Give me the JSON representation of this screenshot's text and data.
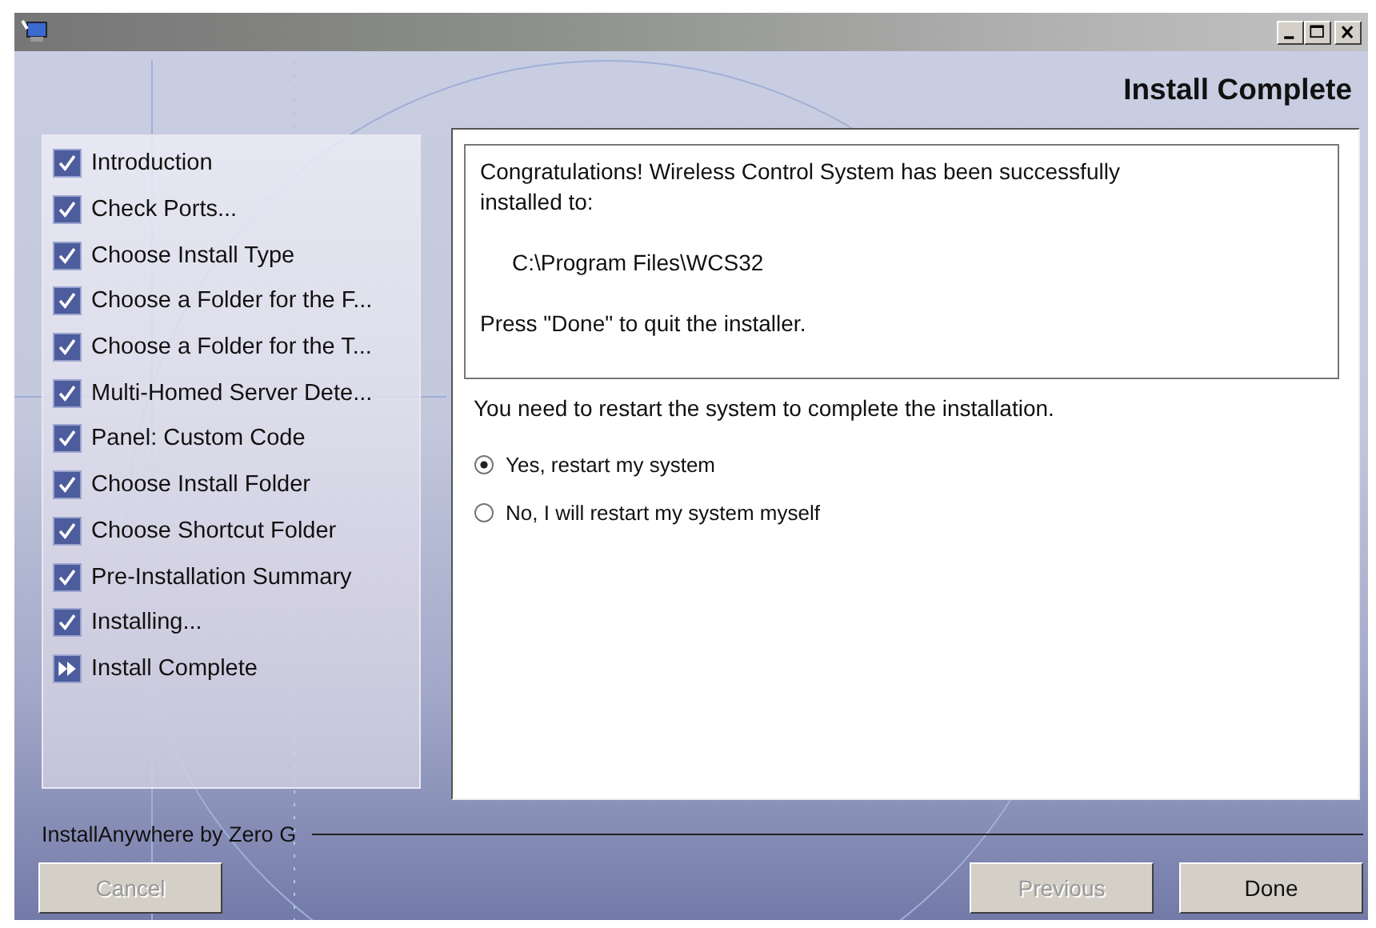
{
  "header": {
    "title": "Install Complete"
  },
  "steps": [
    {
      "label": "Introduction",
      "kind": "done"
    },
    {
      "label": "Check Ports...",
      "kind": "done"
    },
    {
      "label": "Choose Install Type",
      "kind": "done"
    },
    {
      "label": "Choose a Folder for the F...",
      "kind": "done"
    },
    {
      "label": "Choose a Folder for the T...",
      "kind": "done"
    },
    {
      "label": "Multi-Homed Server Dete...",
      "kind": "done"
    },
    {
      "label": "Panel: Custom Code",
      "kind": "done"
    },
    {
      "label": "Choose Install Folder",
      "kind": "done"
    },
    {
      "label": "Choose Shortcut Folder",
      "kind": "done"
    },
    {
      "label": "Pre-Installation Summary",
      "kind": "done"
    },
    {
      "label": "Installing...",
      "kind": "done"
    },
    {
      "label": "Install Complete",
      "kind": "current"
    }
  ],
  "message": {
    "intro": "Congratulations! Wireless Control System has been successfully installed to:",
    "path": "C:\\Program Files\\WCS32",
    "outro": "Press \"Done\" to quit the installer."
  },
  "prompt": "You need to restart the system to complete the installation.",
  "options": [
    {
      "label": "Yes, restart my system",
      "selected": true
    },
    {
      "label": "No, I will restart my system myself",
      "selected": false
    }
  ],
  "footer": {
    "brand": "InstallAnywhere by Zero G"
  },
  "buttons": [
    {
      "label": "Cancel",
      "disabled": true
    },
    {
      "label": "Previous",
      "disabled": true
    },
    {
      "label": "Done",
      "disabled": false
    }
  ]
}
